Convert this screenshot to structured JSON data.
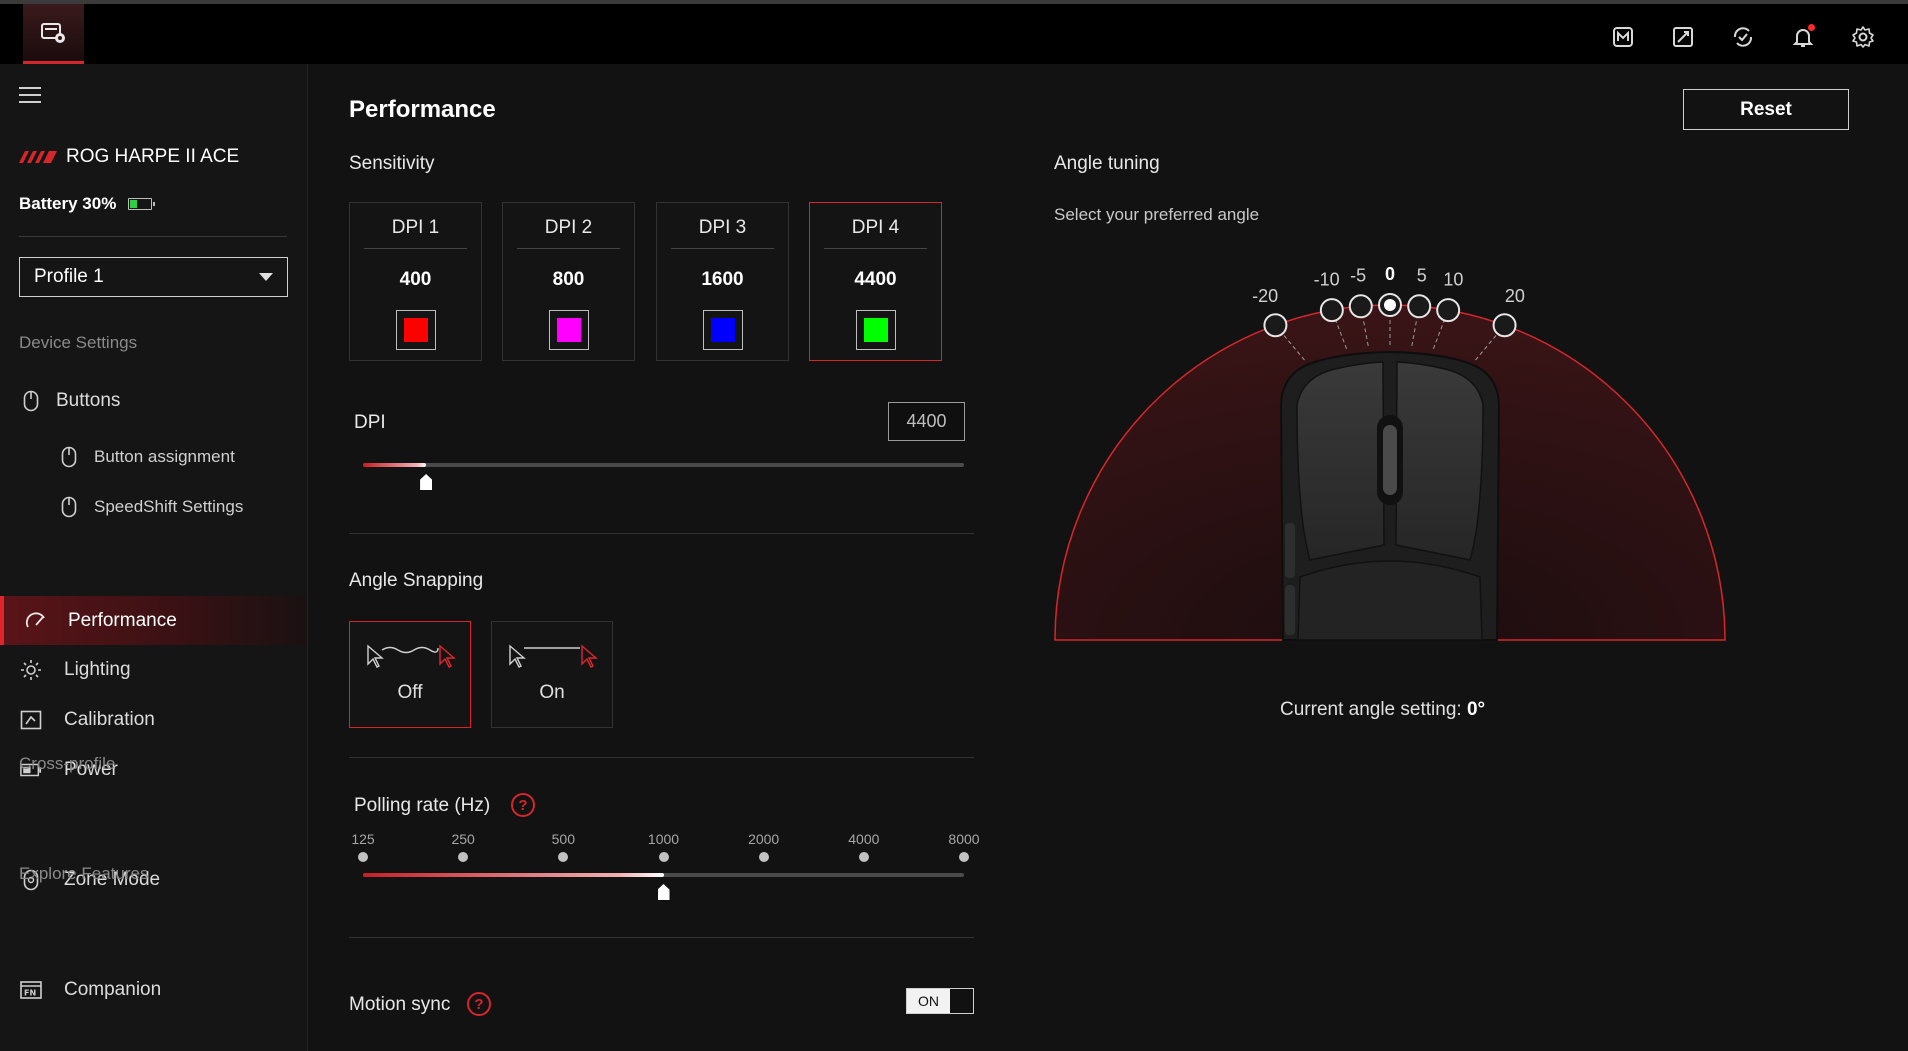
{
  "topbar": {
    "icons": [
      "armoury-crate-icon",
      "mouse-tools-icon",
      "sync-icon",
      "notification-bell-icon",
      "settings-gear-icon"
    ]
  },
  "sidebar": {
    "device_name": "ROG HARPE II ACE",
    "battery": "Battery 30%",
    "battery_level": 0.3,
    "profile": "Profile 1",
    "section_device": "Device Settings",
    "buttons": "Buttons",
    "button_assignment": "Button assignment",
    "speedshift": "SpeedShift Settings",
    "performance": "Performance",
    "lighting": "Lighting",
    "calibration": "Calibration",
    "power": "Power",
    "section_cross": "Cross-profile",
    "zone_mode": "Zone Mode",
    "section_explore": "Explore Features",
    "companion": "Companion"
  },
  "main": {
    "title": "Performance",
    "reset": "Reset",
    "sensitivity": "Sensitivity",
    "dpi_cards": [
      {
        "name": "DPI 1",
        "value": "400",
        "color": "#ff0000"
      },
      {
        "name": "DPI 2",
        "value": "800",
        "color": "#ff00ff"
      },
      {
        "name": "DPI 3",
        "value": "1600",
        "color": "#0000ff"
      },
      {
        "name": "DPI 4",
        "value": "4400",
        "color": "#00ff00"
      }
    ],
    "selected_dpi": "DPI 4",
    "dpi_label": "DPI",
    "dpi_value": "4400",
    "dpi_slider_fraction": 0.105,
    "angle_snapping": "Angle Snapping",
    "snap_off": "Off",
    "snap_on": "On",
    "snap_selected": "Off",
    "polling_label": "Polling rate (Hz)",
    "help": "?",
    "polling_ticks": [
      "125",
      "250",
      "500",
      "1000",
      "2000",
      "4000",
      "8000"
    ],
    "polling_selected": "1000",
    "motion_sync": "Motion sync",
    "motion_sync_state": "ON",
    "accent": "#d7262b"
  },
  "angle": {
    "title": "Angle tuning",
    "subtitle": "Select your preferred angle",
    "options": [
      "-20",
      "-10",
      "-5",
      "0",
      "5",
      "10",
      "20"
    ],
    "selected": "0",
    "current_prefix": "Current angle setting: ",
    "current_value": "0°"
  }
}
